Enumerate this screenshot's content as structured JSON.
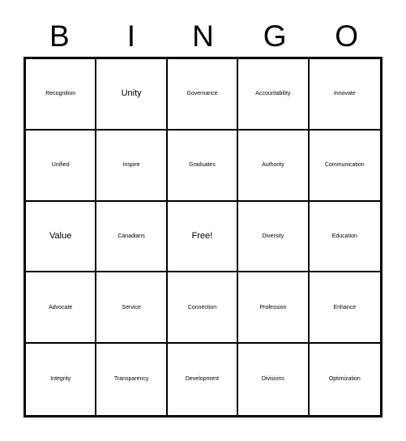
{
  "card": {
    "title": "BINGO",
    "header_letters": [
      "B",
      "I",
      "N",
      "G",
      "O"
    ],
    "colors": {
      "background": "#ffffff",
      "text": "#000000",
      "grid_line": "#000000"
    },
    "grid": {
      "columns": 5,
      "rows": 5,
      "free_space": {
        "row": 2,
        "column": 2,
        "label": "Free!"
      }
    },
    "cells": [
      {
        "label": "Recognition",
        "size": "size-sm"
      },
      {
        "label": "Unity",
        "size": "size-xl"
      },
      {
        "label": "Governance",
        "size": "size-sm"
      },
      {
        "label": "Accountability",
        "size": "size-xxs"
      },
      {
        "label": "Innovate",
        "size": "size-lg"
      },
      {
        "label": "Unified",
        "size": "size-lg"
      },
      {
        "label": "Inspire",
        "size": "size-lg"
      },
      {
        "label": "Graduates",
        "size": "size-md"
      },
      {
        "label": "Authority",
        "size": "size-lg"
      },
      {
        "label": "Communication",
        "size": "size-xxs"
      },
      {
        "label": "Value",
        "size": "size-xl"
      },
      {
        "label": "Canadians",
        "size": "size-md"
      },
      {
        "label": "Free!",
        "size": "size-xl"
      },
      {
        "label": "Diversity",
        "size": "size-lg"
      },
      {
        "label": "Education",
        "size": "size-md"
      },
      {
        "label": "Advocate",
        "size": "size-md"
      },
      {
        "label": "Service",
        "size": "size-lg"
      },
      {
        "label": "Connection",
        "size": "size-sm"
      },
      {
        "label": "Profession",
        "size": "size-md"
      },
      {
        "label": "Enhance",
        "size": "size-lg"
      },
      {
        "label": "Integrity",
        "size": "size-lg"
      },
      {
        "label": "Transparency",
        "size": "size-xs"
      },
      {
        "label": "Development",
        "size": "size-sm"
      },
      {
        "label": "Divisions",
        "size": "size-lg"
      },
      {
        "label": "Optimization",
        "size": "size-xs"
      }
    ]
  }
}
